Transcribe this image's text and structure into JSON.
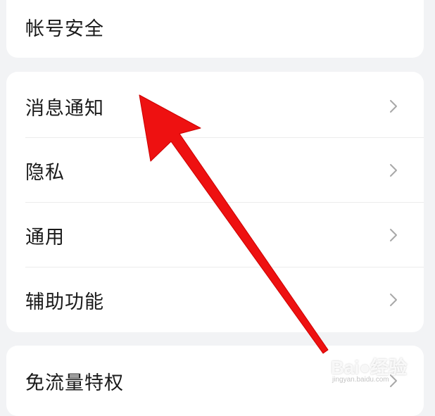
{
  "settings": {
    "account_section": {
      "label": "帐号安全"
    },
    "main_section": {
      "items": [
        {
          "label": "消息通知"
        },
        {
          "label": "隐私"
        },
        {
          "label": "通用"
        },
        {
          "label": "辅助功能"
        }
      ]
    },
    "extra_section": {
      "label": "免流量特权"
    }
  },
  "annotation": {
    "arrow_color": "#ee1111"
  },
  "watermark": {
    "brand": "Bai●经验",
    "url": "jingyan.baidu.com"
  },
  "colors": {
    "background": "#f2f3f5",
    "card": "#ffffff",
    "text": "#1a1a1a",
    "chevron": "#a8a8a8"
  }
}
